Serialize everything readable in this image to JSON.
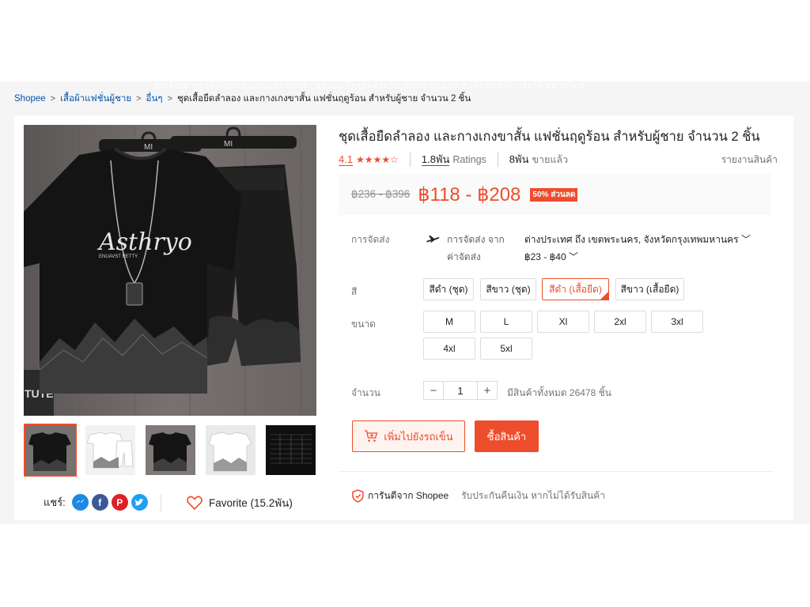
{
  "header": {
    "ghost_nav": "ชุดเสื้อยืด  ชุด  เสื้อผ้าแฟชั่น  กระเป๋า  รองเท้า  ชุดนอน  โทรศัพท์  เครื่องสำอาง  ของเล่น  สินค้า  ลดราคา  เสื้อยืด  หมวก  ไอที"
  },
  "breadcrumb": {
    "items": [
      "Shopee",
      "เสื้อผ้าแฟชั่นผู้ชาย",
      "อื่นๆ"
    ],
    "separator": ">",
    "current": "ชุดเสื้อยืดลำลอง และกางเกงขาสั้น แฟชั่นฤดูร้อน สำหรับผู้ชาย จำนวน 2 ชิ้น"
  },
  "product": {
    "title": "ชุดเสื้อยืดลำลอง และกางเกงขาสั้น แฟชั่นฤดูร้อน สำหรับผู้ชาย จำนวน 2 ชิ้น",
    "rating": "4.1",
    "stars": "★★★★☆",
    "ratings_count": "1.8พัน",
    "ratings_label": "Ratings",
    "sold_count": "8พัน",
    "sold_label": "ขายแล้ว",
    "report_label": "รายงานสินค้า",
    "old_price": "฿236 - ฿396",
    "price": "฿118 - ฿208",
    "discount": "50% ส่วนลด",
    "image_print_text": "Asthryo",
    "image_sub_text": "ENUAVST RETTY",
    "hanger_text": "MI",
    "wall_text": "TUTE"
  },
  "shipping": {
    "label": "การจัดส่ง",
    "from_label": "การจัดส่ง จาก",
    "from_value": "ต่างประเทศ ถึง เขตพระนคร, จังหวัดกรุงเทพมหานคร",
    "fee_label": "ค่าจัดส่ง",
    "fee_value": "฿23 - ฿40",
    "chevron": "﹀"
  },
  "color": {
    "label": "สี",
    "options": [
      "สีดำ (ชุด)",
      "สีขาว (ชุด)",
      "สีดำ (เสื้อยืด)",
      "สีขาว (เสื้อยืด)"
    ],
    "selected_index": 2
  },
  "size": {
    "label": "ขนาด",
    "options": [
      "M",
      "L",
      "Xl",
      "2xl",
      "3xl",
      "4xl",
      "5xl"
    ]
  },
  "quantity": {
    "label": "จำนวน",
    "minus": "−",
    "value": "1",
    "plus": "+",
    "stock_text": "มีสินค้าทั้งหมด 26478 ชิ้น"
  },
  "actions": {
    "add_to_cart": "เพิ่มไปยังรถเข็น",
    "buy_now": "ซื้อสินค้า"
  },
  "guarantee": {
    "title": "การันตีจาก Shopee",
    "description": "รับประกันคืนเงิน หากไม่ได้รับสินค้า"
  },
  "share": {
    "label": "แชร์:",
    "networks": [
      "messenger",
      "facebook",
      "pinterest",
      "twitter"
    ]
  },
  "favorite": {
    "label": "Favorite (15.2พัน)"
  },
  "colors": {
    "accent": "#ee4d2d",
    "link": "#0055aa"
  }
}
